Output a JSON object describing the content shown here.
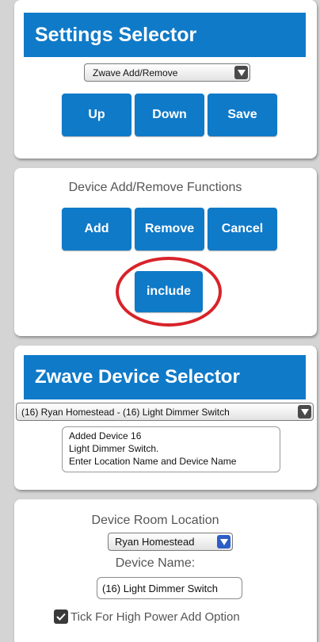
{
  "settings": {
    "title": "Settings Selector",
    "selector_value": "Zwave Add/Remove",
    "buttons": {
      "up": "Up",
      "down": "Down",
      "save": "Save"
    }
  },
  "functions": {
    "title": "Device Add/Remove Functions",
    "buttons": {
      "add": "Add",
      "remove": "Remove",
      "cancel": "Cancel",
      "include": "include"
    },
    "highlight_color": "#d8232a"
  },
  "device_selector": {
    "title": "Zwave Device Selector",
    "selected_device": "(16) Ryan Homestead - (16) Light Dimmer Switch",
    "messages": [
      "Added Device 16",
      "Light Dimmer Switch.",
      "Enter Location Name and Device Name"
    ]
  },
  "room": {
    "location_label": "Device Room Location",
    "location_value": "Ryan Homestead",
    "name_label": "Device Name:",
    "name_value": "(16) Light Dimmer Switch",
    "high_power_label": "Tick For High Power Add Option",
    "high_power_checked": true
  },
  "colors": {
    "accent": "#0f7ac8",
    "background": "#d4d4d4",
    "panel": "#ffffff"
  },
  "icons": {
    "dropdown": "chevron-down-icon",
    "checkbox": "checkmark-icon"
  }
}
